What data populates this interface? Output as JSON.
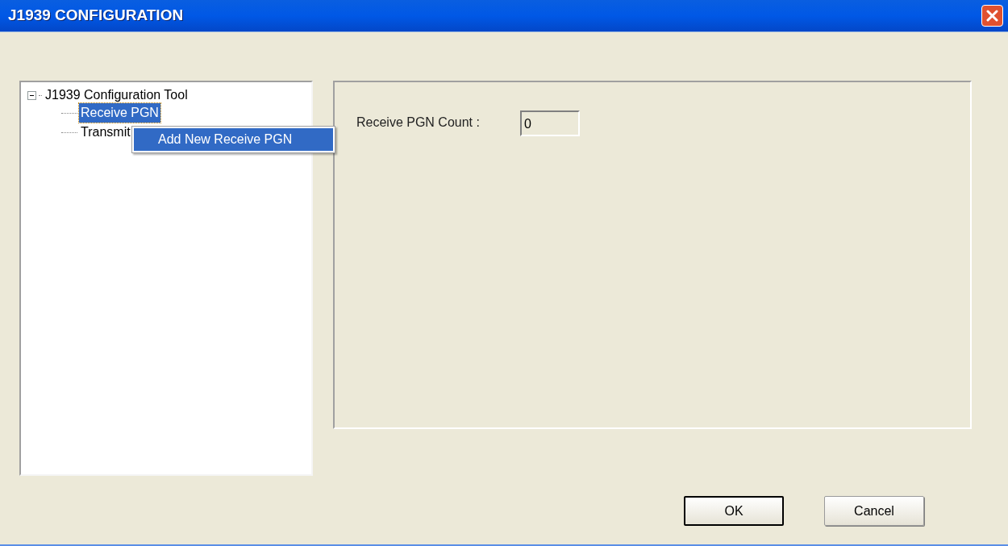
{
  "window": {
    "title": "J1939 CONFIGURATION"
  },
  "tree": {
    "label": "J1939 Configuration Tool",
    "expanded": true,
    "selected": false,
    "children": [
      {
        "label": "Receive PGN",
        "selected": true
      },
      {
        "label": "Transmit",
        "selected": false
      }
    ]
  },
  "context_menu": {
    "items": [
      {
        "label": "Add New Receive PGN",
        "selected": true
      }
    ]
  },
  "details": {
    "label": "Receive PGN Count :",
    "value": "0"
  },
  "buttons": [
    {
      "label": "OK",
      "default": true
    },
    {
      "label": "Cancel",
      "default": false
    }
  ]
}
